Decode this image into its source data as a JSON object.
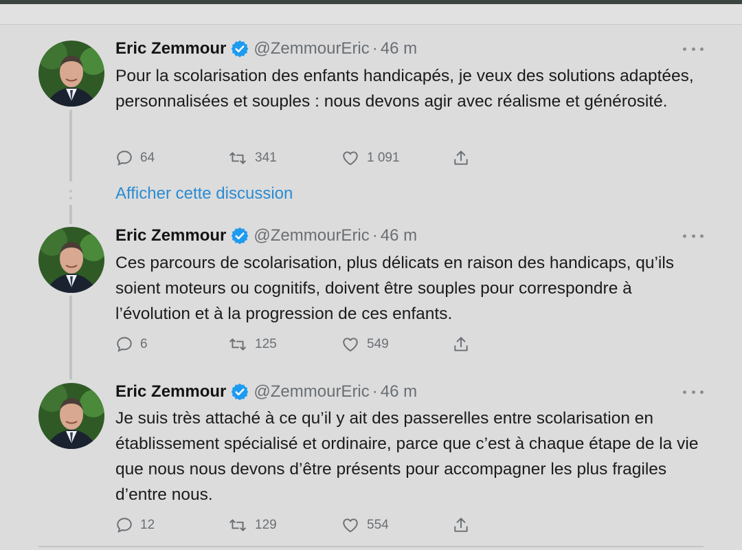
{
  "tweets": [
    {
      "author_name": "Eric Zemmour",
      "handle": "@ZemmourEric",
      "separator": "·",
      "time": "46 m",
      "text": "Pour la scolarisation des enfants handicapés, je veux des solutions adaptées, personnalisées et souples : nous devons agir avec réalisme et générosité.",
      "replies": "64",
      "retweets": "341",
      "likes": "1 091"
    },
    {
      "author_name": "Eric Zemmour",
      "handle": "@ZemmourEric",
      "separator": "·",
      "time": "46 m",
      "text": "Ces parcours de scolarisation, plus délicats en raison des handicaps, qu’ils soient moteurs ou cognitifs, doivent être souples pour correspondre à l’évolution et à la progression de ces enfants.",
      "replies": "6",
      "retweets": "125",
      "likes": "549"
    },
    {
      "author_name": "Eric Zemmour",
      "handle": "@ZemmourEric",
      "separator": "·",
      "time": "46 m",
      "text": "Je suis très attaché à ce qu’il y ait des passerelles entre scolarisation en établissement spécialisé et ordinaire, parce que c’est à chaque étape de la vie que nous nous devons d’être présents pour accompagner les plus fragiles d’entre nous.",
      "replies": "12",
      "retweets": "129",
      "likes": "554"
    }
  ],
  "show_thread_label": "Afficher cette discussion",
  "colors": {
    "background": "#dcdcdc",
    "link": "#2a8bd2",
    "verified": "#1d9bf0",
    "muted": "#6a6f74"
  },
  "icons": [
    "verified-badge-icon",
    "more-icon",
    "reply-icon",
    "retweet-icon",
    "like-icon",
    "share-icon"
  ]
}
